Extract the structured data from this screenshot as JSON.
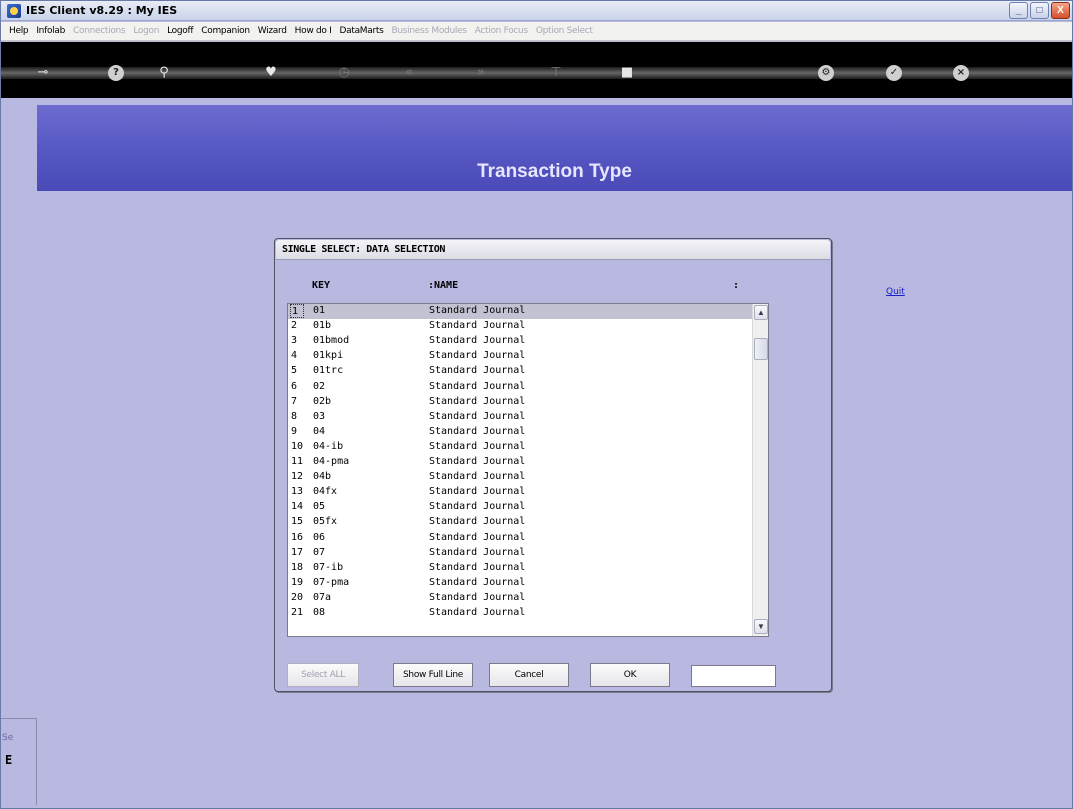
{
  "window": {
    "title": "IES Client v8.29 : My IES",
    "minimize": "_",
    "maximize": "□",
    "close": "X"
  },
  "menu": [
    {
      "label": "Help",
      "disabled": false
    },
    {
      "label": "Infolab",
      "disabled": false
    },
    {
      "label": "Connections",
      "disabled": true
    },
    {
      "label": "Logon",
      "disabled": true
    },
    {
      "label": "Logoff",
      "disabled": false
    },
    {
      "label": "Companion",
      "disabled": false
    },
    {
      "label": "Wizard",
      "disabled": false
    },
    {
      "label": "How do I",
      "disabled": false
    },
    {
      "label": "DataMarts",
      "disabled": false
    },
    {
      "label": "Business Modules",
      "disabled": true
    },
    {
      "label": "Action Focus",
      "disabled": true
    },
    {
      "label": "Option Select",
      "disabled": true
    }
  ],
  "toolbar": {
    "icons": [
      {
        "name": "key-icon",
        "glyph": "⊸",
        "dim": false
      },
      {
        "name": "help-icon",
        "glyph": "?",
        "dim": false,
        "circle": true
      },
      {
        "name": "search-icon",
        "glyph": "⚲",
        "dim": false
      },
      {
        "name": "heart-icon",
        "glyph": "♥",
        "dim": false
      },
      {
        "name": "clock-icon",
        "glyph": "◷",
        "dim": true
      },
      {
        "name": "rewind-icon",
        "glyph": "«",
        "dim": true
      },
      {
        "name": "forward-icon",
        "glyph": "»",
        "dim": true
      },
      {
        "name": "tree-icon",
        "glyph": "⊤",
        "dim": true
      },
      {
        "name": "stop-icon",
        "glyph": "■",
        "dim": false
      },
      {
        "name": "settings-icon",
        "glyph": "⚙",
        "dim": false,
        "circle": true
      },
      {
        "name": "check-icon",
        "glyph": "✓",
        "dim": false,
        "circle": true
      },
      {
        "name": "exit-icon",
        "glyph": "×",
        "dim": false,
        "circle": true
      }
    ]
  },
  "banner": {
    "title": "Transaction Type"
  },
  "quit": {
    "label": "Quit"
  },
  "dialog": {
    "title": "SINGLE SELECT: DATA SELECTION",
    "headers": {
      "key": "KEY",
      "name": ":NAME",
      "extra": ":"
    },
    "rows": [
      {
        "num": "1",
        "key": "01",
        "name": "Standard Journal"
      },
      {
        "num": "2",
        "key": "01b",
        "name": "Standard Journal"
      },
      {
        "num": "3",
        "key": "01bmod",
        "name": "Standard Journal"
      },
      {
        "num": "4",
        "key": "01kpi",
        "name": "Standard Journal"
      },
      {
        "num": "5",
        "key": "01trc",
        "name": "Standard Journal"
      },
      {
        "num": "6",
        "key": "02",
        "name": "Standard Journal"
      },
      {
        "num": "7",
        "key": "02b",
        "name": "Standard Journal"
      },
      {
        "num": "8",
        "key": "03",
        "name": "Standard Journal"
      },
      {
        "num": "9",
        "key": "04",
        "name": "Standard Journal"
      },
      {
        "num": "10",
        "key": "04-ib",
        "name": "Standard Journal"
      },
      {
        "num": "11",
        "key": "04-pma",
        "name": "Standard Journal"
      },
      {
        "num": "12",
        "key": "04b",
        "name": "Standard Journal"
      },
      {
        "num": "13",
        "key": "04fx",
        "name": "Standard Journal"
      },
      {
        "num": "14",
        "key": "05",
        "name": "Standard Journal"
      },
      {
        "num": "15",
        "key": "05fx",
        "name": "Standard Journal"
      },
      {
        "num": "16",
        "key": "06",
        "name": "Standard Journal"
      },
      {
        "num": "17",
        "key": "07",
        "name": "Standard Journal"
      },
      {
        "num": "18",
        "key": "07-ib",
        "name": "Standard Journal"
      },
      {
        "num": "19",
        "key": "07-pma",
        "name": "Standard Journal"
      },
      {
        "num": "20",
        "key": "07a",
        "name": "Standard Journal"
      },
      {
        "num": "21",
        "key": "08",
        "name": "Standard Journal"
      }
    ],
    "selected_index": 0,
    "buttons": {
      "select_all": "Select ALL",
      "show_full_line": "Show Full Line",
      "cancel": "Cancel",
      "ok": "OK"
    },
    "input_value": ""
  },
  "side_panel": {
    "label": "Se",
    "glyph": "E"
  },
  "colors": {
    "background": "#b8b8e0",
    "banner": "#5858c4",
    "selection": "#c2c2d2",
    "link": "#1a22c8"
  }
}
